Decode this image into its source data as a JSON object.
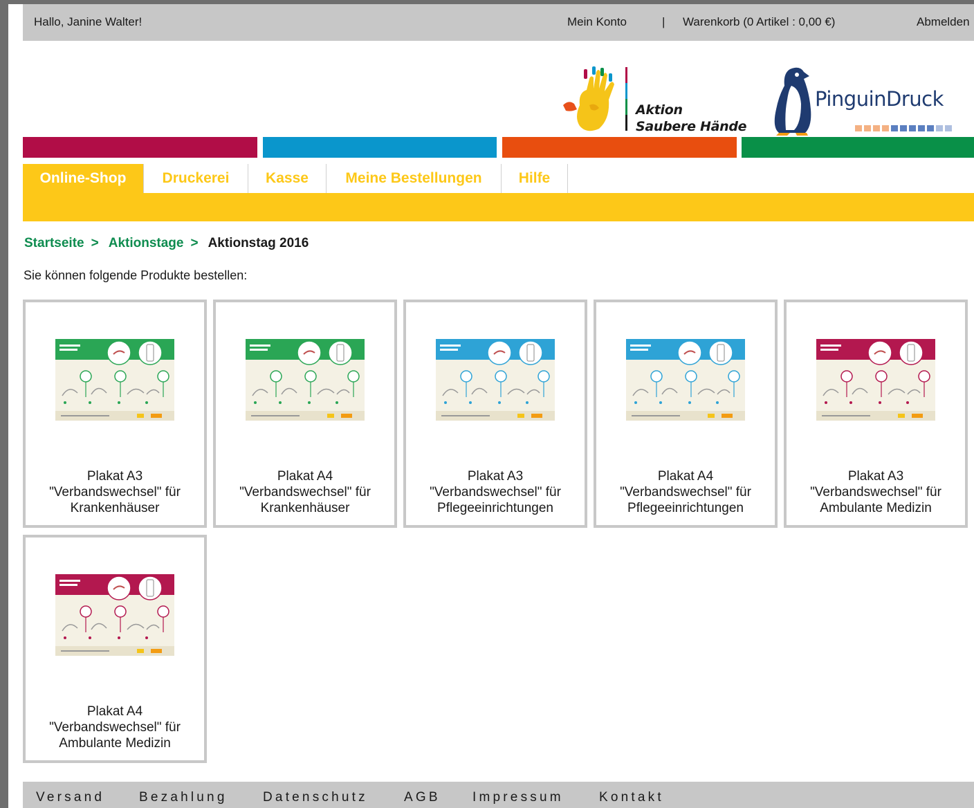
{
  "userbar": {
    "greeting": "Hallo, Janine Walter!",
    "account": "Mein Konto",
    "separator": "|",
    "cart": "Warenkorb (0 Artikel : 0,00 €)",
    "logout": "Abmelden"
  },
  "logos": {
    "aktion_line1": "Aktion",
    "aktion_line2": "Saubere Hände",
    "pinguin": "PinguinDruck"
  },
  "colors": {
    "bar1": "#b10d47",
    "bar2": "#0a96cc",
    "bar3": "#e84e0f",
    "bar4": "#099048",
    "nav_yellow": "#fdc818",
    "link_green": "#0e8c4f"
  },
  "nav": {
    "tabs": [
      {
        "label": "Online-Shop",
        "active": true
      },
      {
        "label": "Druckerei",
        "active": false
      },
      {
        "label": "Kasse",
        "active": false
      },
      {
        "label": "Meine Bestellungen",
        "active": false
      },
      {
        "label": "Hilfe",
        "active": false
      }
    ]
  },
  "breadcrumb": {
    "items": [
      "Startseite",
      "Aktionstage"
    ],
    "arrow": ">",
    "current": "Aktionstag 2016"
  },
  "intro": "Sie können folgende Produkte bestellen:",
  "products": [
    {
      "line1": "Plakat A3",
      "line2": "\"Verbandswechsel\" für",
      "line3": "Krankenhäuser",
      "color": "#2aa655"
    },
    {
      "line1": "Plakat A4",
      "line2": "\"Verbandswechsel\" für",
      "line3": "Krankenhäuser",
      "color": "#2aa655"
    },
    {
      "line1": "Plakat A3",
      "line2": "\"Verbandswechsel\" für",
      "line3": "Pflegeeinrichtungen",
      "color": "#2ea3d6"
    },
    {
      "line1": "Plakat A4",
      "line2": "\"Verbandswechsel\" für",
      "line3": "Pflegeeinrichtungen",
      "color": "#2ea3d6"
    },
    {
      "line1": "Plakat A3",
      "line2": "\"Verbandswechsel\" für",
      "line3": "Ambulante Medizin",
      "color": "#b3184f"
    },
    {
      "line1": "Plakat A4",
      "line2": "\"Verbandswechsel\" für",
      "line3": "Ambulante Medizin",
      "color": "#b3184f"
    }
  ],
  "footer": {
    "links": [
      "Versand",
      "Bezahlung",
      "Datenschutz",
      "AGB",
      "Impressum",
      "Kontakt"
    ]
  }
}
